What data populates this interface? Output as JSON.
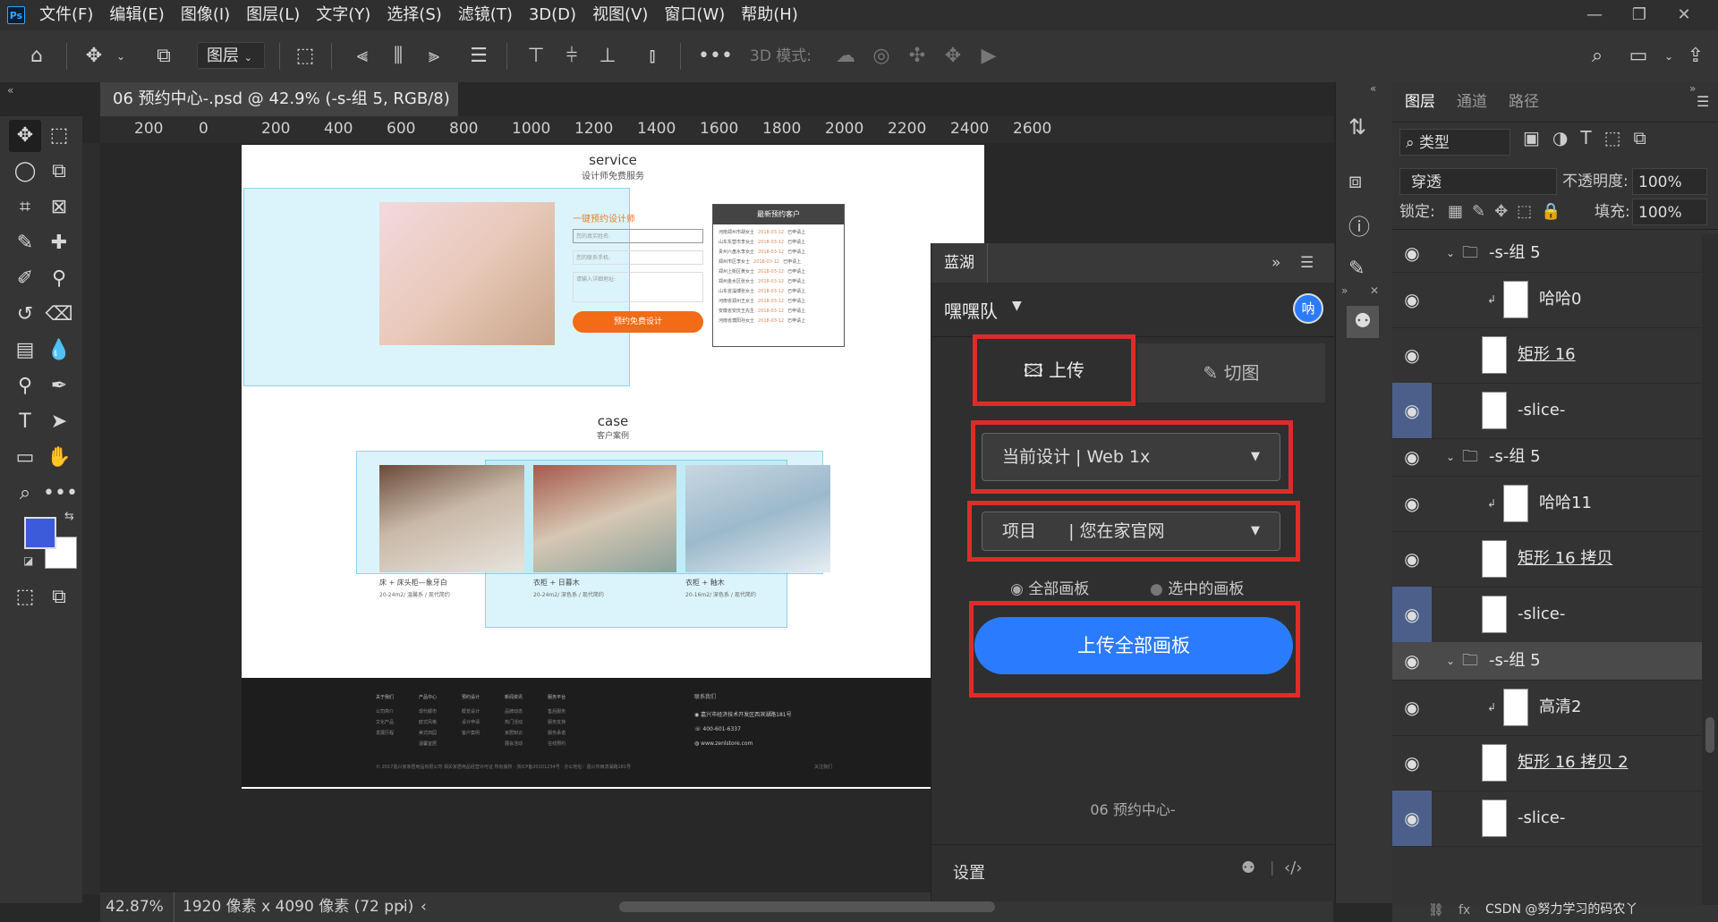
{
  "menubar": {
    "logo": "Ps",
    "items": [
      "文件(F)",
      "编辑(E)",
      "图像(I)",
      "图层(L)",
      "文字(Y)",
      "选择(S)",
      "滤镜(T)",
      "3D(D)",
      "视图(V)",
      "窗口(W)",
      "帮助(H)"
    ]
  },
  "options": {
    "layer_select": "图层",
    "mode3d": "3D 模式:"
  },
  "document": {
    "tab_title": "06 预约中心-.psd @ 42.9% (-s-组 5, RGB/8) *",
    "ruler_ticks": [
      "200",
      "0",
      "200",
      "400",
      "600",
      "800",
      "1000",
      "1200",
      "1400",
      "1600",
      "1800",
      "2000",
      "2200",
      "2400",
      "2600"
    ]
  },
  "artboard": {
    "service_title": "service",
    "service_sub": "设计师免费服务",
    "form_title": "一键预约设计师",
    "form_fields": [
      "您的真实姓名:",
      "您的联系手机:",
      "请输入详细地址:"
    ],
    "form_button": "预约免费设计",
    "clients_title": "最新预约客户",
    "clients": [
      [
        "河南郑州市胡女士",
        "2018-03-12",
        "已申请上"
      ],
      [
        "山东东营市李女士",
        "2018-03-12",
        "已申请上"
      ],
      [
        "贵州六盘水李女士",
        "2018-03-12",
        "已申请上"
      ],
      [
        "郑州市区李女士",
        "2018-03-12",
        "已申请上"
      ],
      [
        "郑州上街区黄女士",
        "2018-03-12",
        "已申请上"
      ],
      [
        "郑州金水区张女士",
        "2018-03-12",
        "已申请上"
      ],
      [
        "山东省淄博张女士",
        "2018-03-12",
        "已申请上"
      ],
      [
        "河南省郑州王女士",
        "2018-03-12",
        "已申请上"
      ],
      [
        "安徽省安庆王先生",
        "2018-03-12",
        "已申请上"
      ],
      [
        "河南省濮阳孙女士",
        "2018-03-12",
        "已申请上"
      ]
    ],
    "case_title": "case",
    "case_sub": "客户案例",
    "cases": [
      {
        "name": "床 + 床头柜—象牙白",
        "meta": "20-24m2/ 温馨系 / 现代简约"
      },
      {
        "name": "衣柜 + 日暮木",
        "meta": "20-24m2/ 深色系 / 现代简约"
      },
      {
        "name": "衣柜 + 釉木",
        "meta": "20-16m2/ 深色系 / 现代简约"
      }
    ],
    "footer_cols": [
      {
        "title": "关于我们",
        "items": [
          "公司简介",
          "文化产品",
          "发展历程"
        ]
      },
      {
        "title": "产品中心",
        "items": [
          "现代都市",
          "欧式风格",
          "美式田园",
          "温馨宜居"
        ]
      },
      {
        "title": "预约设计",
        "items": [
          "概览设计",
          "设计申请",
          "客户案例"
        ]
      },
      {
        "title": "新闻资讯",
        "items": [
          "品牌动态",
          "热门活动",
          "家居知识",
          "展会活动"
        ]
      },
      {
        "title": "服务平台",
        "items": [
          "售后服务",
          "服务支持",
          "服务承诺",
          "在线预约"
        ]
      }
    ],
    "contact_title": "联系我们",
    "contact_address": "嘉兴市经济技术开发区西滨湖路181号",
    "contact_phone": "400-601-6337",
    "contact_web": "www.zenlstore.com",
    "copyright": "© 2017嘉兴家家居用品有限公司 相关家居用品经营许可证 所有版权 · 浙ICP备20101234号 · 办公地址：嘉兴市西滨湖路181号",
    "footer_follow": "关注我们"
  },
  "status": {
    "zoom": "42.87%",
    "size": "1920 像素 x 4090 像素 (72 ppi)"
  },
  "plugin": {
    "title": "蓝湖",
    "team": "嘿嘿队",
    "avatar": "呐",
    "tab_upload": "上传",
    "tab_slice": "切图",
    "design_select": "当前设计 | Web 1x",
    "project_label": "项目",
    "project_value": "| 您在家官网",
    "radio_all": "全部画板",
    "radio_selected": "选中的画板",
    "upload_button": "上传全部画板",
    "file_name": "06 预约中心-",
    "settings": "设置",
    "accent": "#2b7bff",
    "highlight": "#e02b2b"
  },
  "layers_panel": {
    "tabs": [
      "图层",
      "通道",
      "路径"
    ],
    "filter": "类型",
    "blend": "穿透",
    "opacity_label": "不透明度:",
    "opacity_value": "100%",
    "lock_label": "锁定:",
    "fill_label": "填充:",
    "fill_value": "100%",
    "layers": [
      {
        "name": "-s-组 5",
        "kind": "group"
      },
      {
        "name": "哈哈0",
        "kind": "smart"
      },
      {
        "name": "矩形 16",
        "kind": "smart-ul"
      },
      {
        "name": "-slice-",
        "kind": "slice"
      },
      {
        "name": "-s-组 5",
        "kind": "group"
      },
      {
        "name": "哈哈11",
        "kind": "smart"
      },
      {
        "name": "矩形 16 拷贝",
        "kind": "smart-ul"
      },
      {
        "name": "-slice-",
        "kind": "slice"
      },
      {
        "name": "-s-组 5",
        "kind": "group-selected"
      },
      {
        "name": "高清2",
        "kind": "smart"
      },
      {
        "name": "矩形 16 拷贝 2",
        "kind": "smart-ul"
      },
      {
        "name": "-slice-",
        "kind": "slice"
      }
    ],
    "watermark": "CSDN @努力学习的码农丫"
  }
}
